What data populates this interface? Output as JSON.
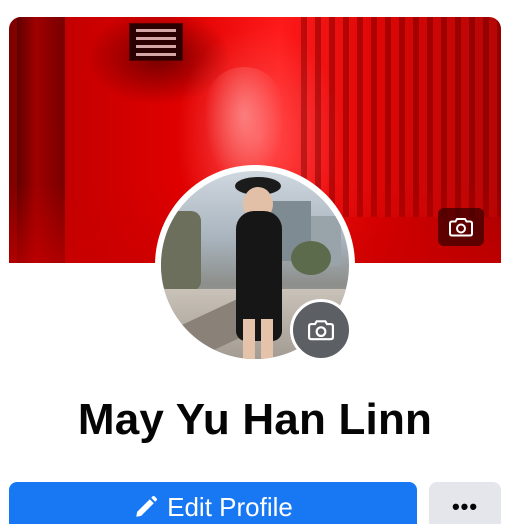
{
  "profile": {
    "name": "May Yu Han Linn"
  },
  "actions": {
    "edit_profile_label": "Edit Profile",
    "more_label": "•••"
  },
  "icons": {
    "cover_camera": "camera-icon",
    "avatar_camera": "camera-icon",
    "edit": "pencil-icon"
  },
  "colors": {
    "primary_button": "#1877f2",
    "secondary_button": "#e4e6eb",
    "cover_tint": "#e00000",
    "name_text": "#050505"
  }
}
